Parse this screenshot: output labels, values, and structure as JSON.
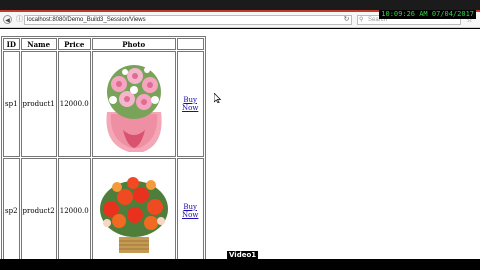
{
  "overlay": {
    "timestamp": "10:09:26 AM 07/04/2017",
    "video_label": "Video1"
  },
  "browser": {
    "url": "localhost:8080/Demo_Build3_Session/Views",
    "search_placeholder": "Search"
  },
  "table": {
    "headers": [
      "ID",
      "Name",
      "Price",
      "Photo",
      ""
    ],
    "rows": [
      {
        "id": "sp1",
        "name": "product1",
        "price": "12000.0",
        "action": "Buy Now",
        "photo": "pink-rose-bouquet"
      },
      {
        "id": "sp2",
        "name": "product2",
        "price": "12000.0",
        "action": "Buy Now",
        "photo": "red-flower-basket"
      }
    ]
  },
  "colors": {
    "timestamp_green": "#3ad24a",
    "link_blue": "#1a0dab",
    "title_red_line": "#c0392b"
  }
}
